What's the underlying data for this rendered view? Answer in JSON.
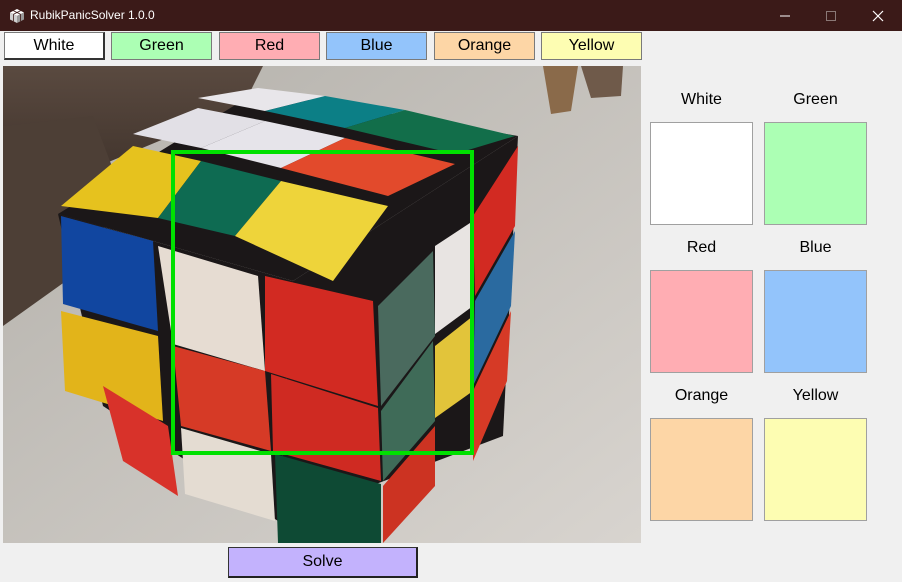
{
  "window": {
    "title": "RubikPanicSolver 1.0.0"
  },
  "color_buttons": [
    {
      "label": "White"
    },
    {
      "label": "Green"
    },
    {
      "label": "Red"
    },
    {
      "label": "Blue"
    },
    {
      "label": "Orange"
    },
    {
      "label": "Yellow"
    }
  ],
  "swatches": [
    {
      "label": "White",
      "color": "#ffffff"
    },
    {
      "label": "Green",
      "color": "#acffb4"
    },
    {
      "label": "Red",
      "color": "#ffadb3"
    },
    {
      "label": "Blue",
      "color": "#93c4fb"
    },
    {
      "label": "Orange",
      "color": "#fdd6a6"
    },
    {
      "label": "Yellow",
      "color": "#fdfdb2"
    }
  ],
  "solve_button": {
    "label": "Solve"
  },
  "colors": {
    "titlebar": "#3b1a18",
    "detection_frame": "#00e000",
    "solve_button": "#c3b2fd"
  },
  "icons": {
    "app": "rubik-cube-icon",
    "minimize": "minimize-icon",
    "maximize": "maximize-icon",
    "close": "close-icon"
  }
}
